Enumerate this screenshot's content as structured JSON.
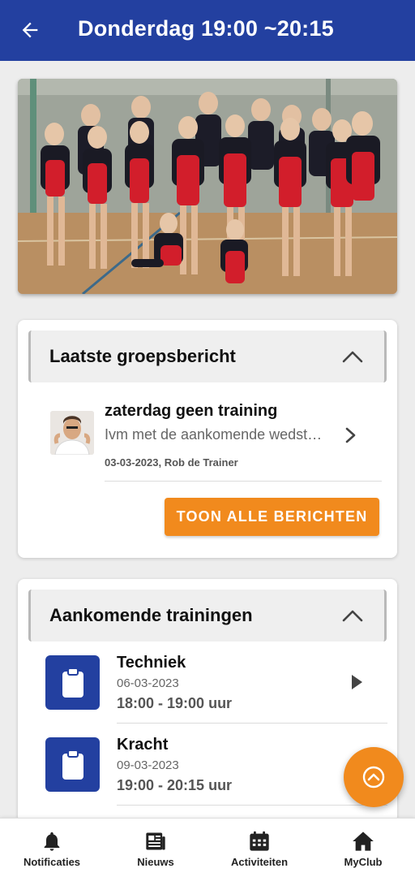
{
  "header": {
    "title": "Donderdag 19:00 ~20:15",
    "back_icon": "arrow-left-icon"
  },
  "hero": {
    "image": "team-photo"
  },
  "messages_card": {
    "title": "Laatste groepsbericht",
    "collapse_icon": "chevron-up-icon",
    "message": {
      "title": "zaterdag geen training",
      "preview": "Ivm met de aankomende wedstrijd",
      "meta": "03-03-2023, Rob de Trainer",
      "avatar": "trainer-avatar"
    },
    "button_label": "TOON ALLE BERICHTEN"
  },
  "trainings_card": {
    "title": "Aankomende trainingen",
    "collapse_icon": "chevron-up-icon",
    "items": [
      {
        "title": "Techniek",
        "date": "06-03-2023",
        "time": "18:00 - 19:00 uur",
        "icon": "clipboard-icon"
      },
      {
        "title": "Kracht",
        "date": "09-03-2023",
        "time": "19:00 - 20:15 uur",
        "icon": "clipboard-icon"
      }
    ]
  },
  "fab": {
    "icon": "chevron-up-icon"
  },
  "bottom_nav": {
    "items": [
      {
        "label": "Notificaties",
        "icon": "bell-icon"
      },
      {
        "label": "Nieuws",
        "icon": "newspaper-icon"
      },
      {
        "label": "Activiteiten",
        "icon": "calendar-icon"
      },
      {
        "label": "MyClub",
        "icon": "home-icon"
      }
    ]
  },
  "colors": {
    "primary": "#2340a0",
    "accent": "#f18a1d",
    "background": "#ededed"
  }
}
